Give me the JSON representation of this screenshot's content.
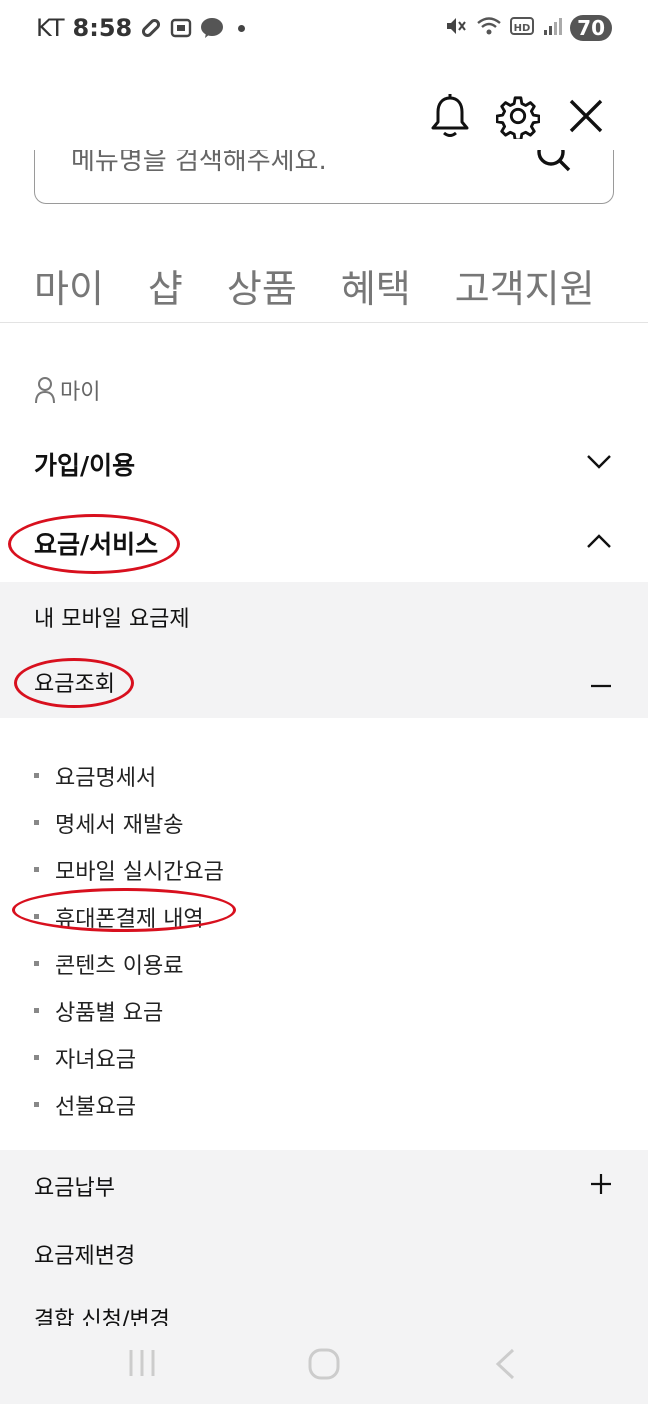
{
  "status": {
    "carrier": "KT",
    "time": "8:58",
    "battery": "70"
  },
  "header": {
    "icons": [
      "bell-icon",
      "gear-icon",
      "close-icon"
    ]
  },
  "search": {
    "placeholder": "메뉴명을 검색해주세요."
  },
  "tabs": [
    "마이",
    "샵",
    "상품",
    "혜택",
    "고객지원"
  ],
  "section": {
    "label": "마이"
  },
  "accordion": {
    "join": "가입/이용",
    "fee_service": "요금/서비스",
    "my_mobile_plan": "내 모바일 요금제",
    "fee_inquiry": "요금조회",
    "fee_inquiry_items": [
      "요금명세서",
      "명세서 재발송",
      "모바일 실시간요금",
      "휴대폰결제 내역",
      "콘텐츠 이용료",
      "상품별 요금",
      "자녀요금",
      "선불요금"
    ],
    "fee_payment": "요금납부",
    "plan_change": "요금제변경",
    "combo": "결합 신청/변경"
  },
  "colors": {
    "highlight": "#d8101e",
    "submenu_bg": "#f3f3f4"
  }
}
